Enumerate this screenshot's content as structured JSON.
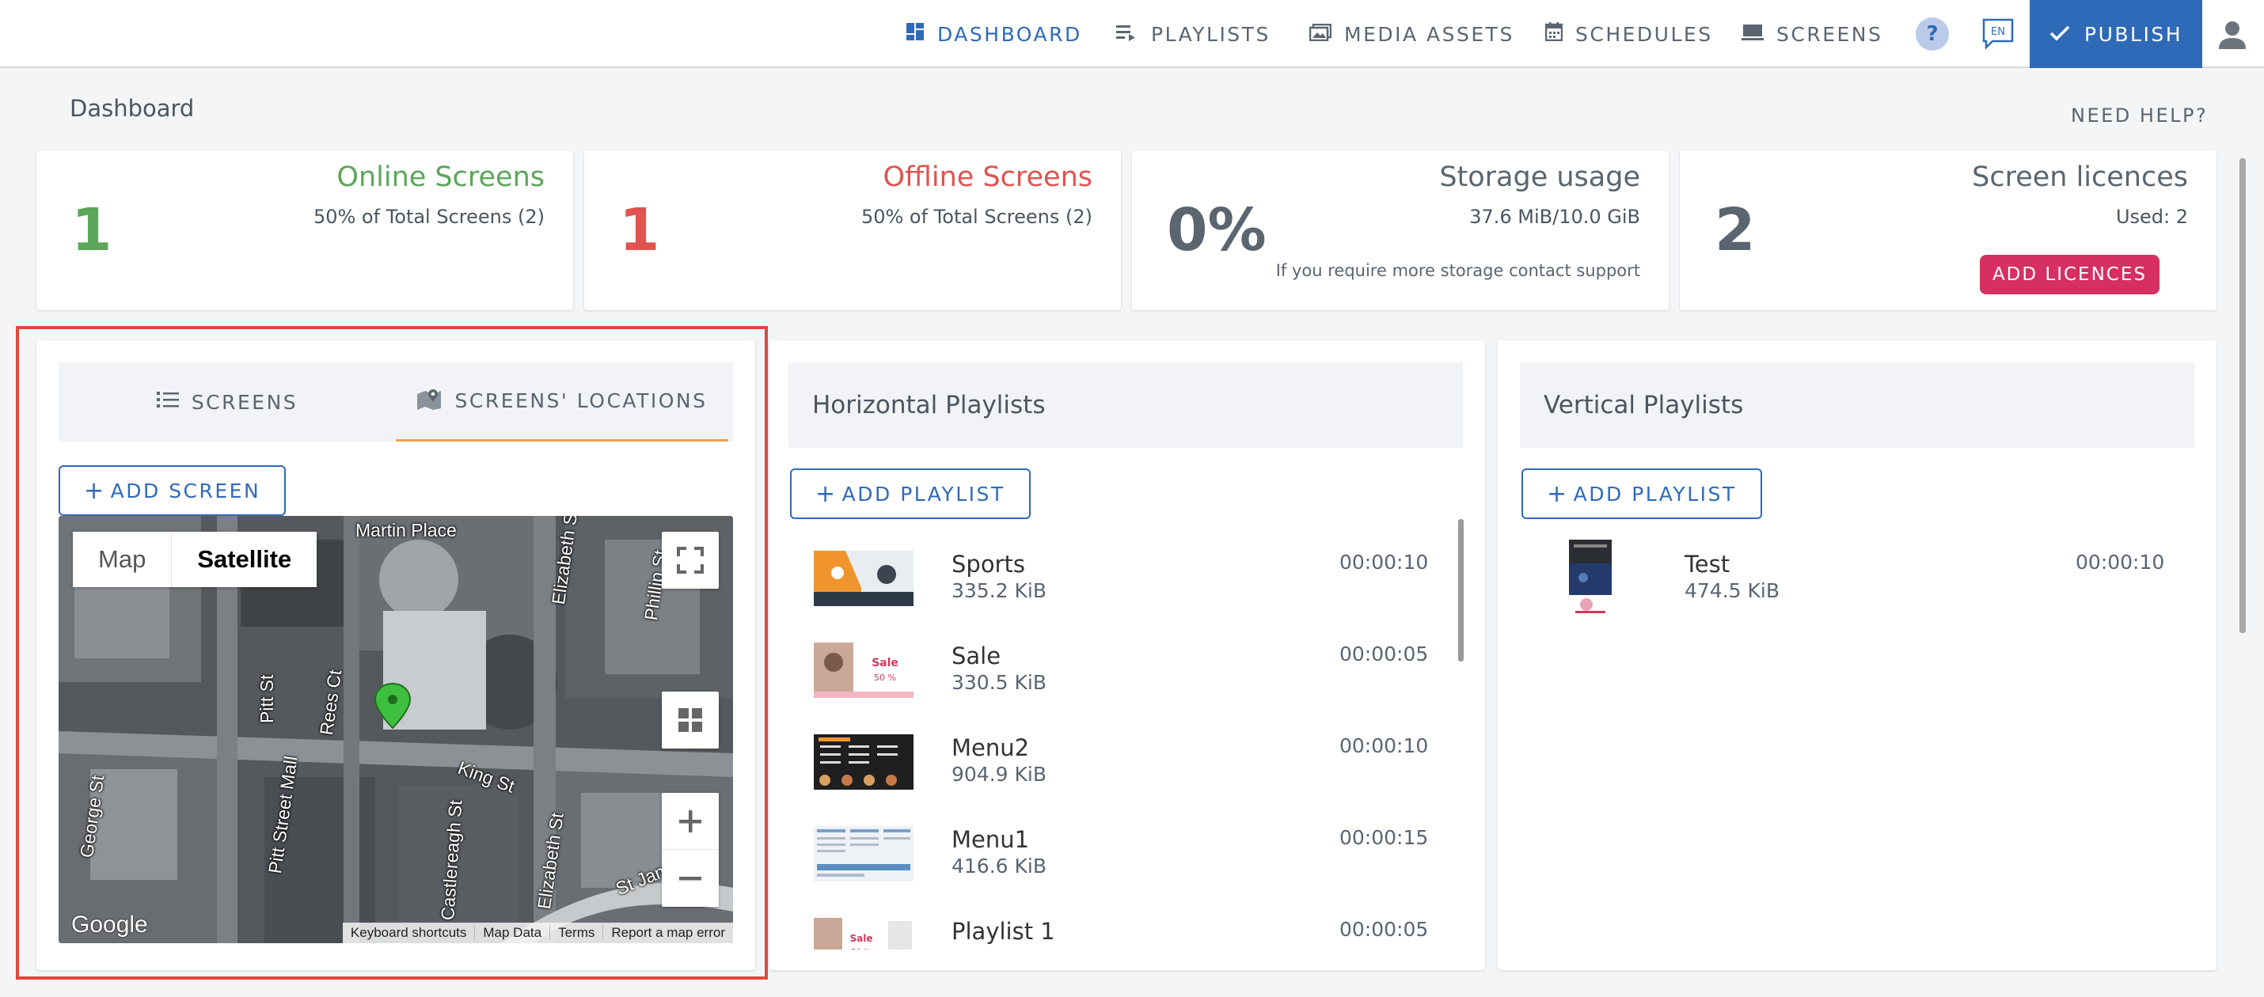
{
  "nav": {
    "items": [
      {
        "label": "DASHBOARD",
        "icon": "dashboard-icon",
        "active": true
      },
      {
        "label": "PLAYLISTS",
        "icon": "playlist-icon",
        "active": false
      },
      {
        "label": "MEDIA ASSETS",
        "icon": "media-assets-icon",
        "active": false
      },
      {
        "label": "SCHEDULES",
        "icon": "calendar-icon",
        "active": false
      },
      {
        "label": "SCREENS",
        "icon": "monitor-icon",
        "active": false
      }
    ],
    "help_label": "?",
    "language": "EN",
    "publish_label": "PUBLISH"
  },
  "page": {
    "title": "Dashboard",
    "need_help": "NEED HELP?"
  },
  "stats": {
    "online": {
      "value": "1",
      "title": "Online Screens",
      "sub": "50% of Total Screens (2)"
    },
    "offline": {
      "value": "1",
      "title": "Offline Screens",
      "sub": "50% of Total Screens (2)"
    },
    "storage": {
      "value": "0%",
      "title": "Storage usage",
      "sub": "37.6 MiB/10.0 GiB",
      "note": "If you require more storage contact support"
    },
    "licences": {
      "value": "2",
      "title": "Screen licences",
      "sub": "Used: 2",
      "button": "ADD LICENCES"
    }
  },
  "screens_panel": {
    "tabs": [
      {
        "label": "SCREENS",
        "active": false
      },
      {
        "label": "SCREENS' LOCATIONS",
        "active": true
      }
    ],
    "add_button": "ADD SCREEN",
    "map": {
      "type_options": [
        "Map",
        "Satellite"
      ],
      "selected_type": "Satellite",
      "streets": [
        "Martin Place",
        "Elizabeth St",
        "Phillip St",
        "Pitt St",
        "Rees Ct",
        "King St",
        "George St",
        "Pitt Street Mall",
        "Castlereagh St",
        "Elizabeth St",
        "St James"
      ],
      "footer": [
        "Keyboard shortcuts",
        "Map Data",
        "Terms",
        "Report a map error"
      ],
      "logo": "Google"
    }
  },
  "horizontal_playlists": {
    "title": "Horizontal Playlists",
    "add_button": "ADD PLAYLIST",
    "items": [
      {
        "name": "Sports",
        "size": "335.2 KiB",
        "duration": "00:00:10"
      },
      {
        "name": "Sale",
        "size": "330.5 KiB",
        "duration": "00:00:05"
      },
      {
        "name": "Menu2",
        "size": "904.9 KiB",
        "duration": "00:00:10"
      },
      {
        "name": "Menu1",
        "size": "416.6 KiB",
        "duration": "00:00:15"
      },
      {
        "name": "Playlist 1",
        "size": "",
        "duration": "00:00:05"
      }
    ]
  },
  "vertical_playlists": {
    "title": "Vertical Playlists",
    "add_button": "ADD PLAYLIST",
    "items": [
      {
        "name": "Test",
        "size": "474.5 KiB",
        "duration": "00:00:10"
      }
    ]
  },
  "colors": {
    "accent": "#2f6ab8",
    "online": "#5ba65a",
    "offline": "#e0534f",
    "licence_button": "#d62f63",
    "active_tab_underline": "#f0a04b",
    "highlight_border": "#e2483d"
  }
}
